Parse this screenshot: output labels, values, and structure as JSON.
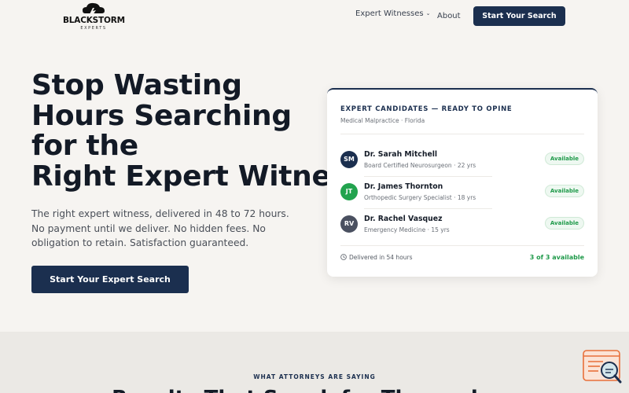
{
  "nav": {
    "logo_text": "BLACKSTORM",
    "logo_sub": "EXPERTS",
    "links": [
      "Expert Witnesses",
      "About"
    ],
    "cta": "Start Your Search"
  },
  "hero": {
    "title_lines": [
      "Stop Wasting",
      "Hours Searching",
      "for the",
      "Right Expert Witness"
    ],
    "subtitle_lines": [
      "The right expert witness, delivered in 48 to 72 hours.",
      "No payment until we deliver. No hidden fees. No",
      "obligation to retain. Satisfaction guaranteed."
    ],
    "cta": "Start Your Expert Search"
  },
  "card": {
    "title": "EXPERT CANDIDATES — READY TO OPINE",
    "meta": "Medical Malpractice · Florida",
    "candidates": [
      {
        "initials": "SM",
        "name": "Dr. Sarah Mitchell",
        "detail": "Board Certified Neurosurgeon · 22 yrs",
        "status": "Available",
        "color": "#1b2f4f"
      },
      {
        "initials": "JT",
        "name": "Dr. James Thornton",
        "detail": "Orthopedic Surgery Specialist · 18 yrs",
        "status": "Available",
        "color": "#22a34e"
      },
      {
        "initials": "RV",
        "name": "Dr. Rachel Vasquez",
        "detail": "Emergency Medicine · 15 yrs",
        "status": "Available",
        "color": "#4a5060"
      }
    ],
    "delivered": "Delivered in 54 hours",
    "available_count": "3 of 3 available"
  },
  "section": {
    "eyebrow": "WHAT ATTORNEYS ARE SAYING",
    "heading": "Results That Speak for Themselves"
  },
  "colors": {
    "brand": "#1b2f4f",
    "success": "#1f9a4a",
    "widget": "#e8703a"
  }
}
